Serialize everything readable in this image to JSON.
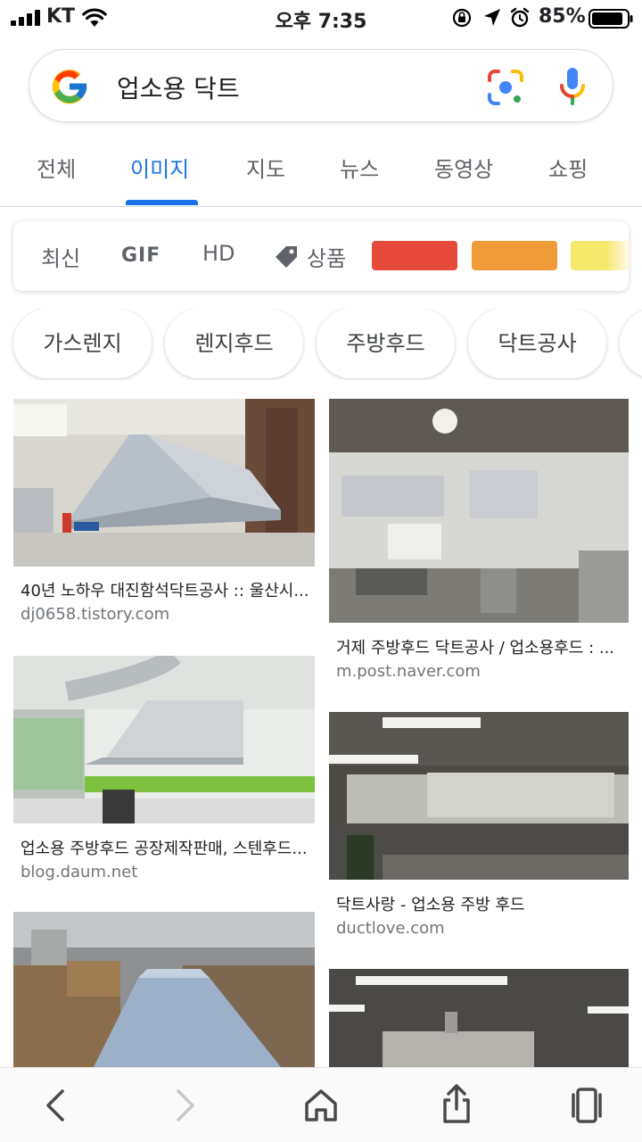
{
  "status_bar": {
    "carrier": "KT",
    "time": "오후 7:35",
    "battery": "85%"
  },
  "search": {
    "query": "업소용 닥트"
  },
  "tabs": [
    {
      "label": "전체"
    },
    {
      "label": "이미지"
    },
    {
      "label": "지도"
    },
    {
      "label": "뉴스"
    },
    {
      "label": "동영상"
    },
    {
      "label": "쇼핑"
    }
  ],
  "filters": {
    "newest": "최신",
    "gif": "GIF",
    "hd": "HD",
    "products": "상품",
    "colors": [
      "#e64a3b",
      "#f19a38",
      "#f7e76a"
    ]
  },
  "chips": [
    {
      "label": "가스렌지"
    },
    {
      "label": "렌지후드"
    },
    {
      "label": "주방후드"
    },
    {
      "label": "닥트공사"
    }
  ],
  "results": [
    {
      "title": "40년 노하우 대진함석닥트공사 :: 울산시...",
      "domain": "dj0658.tistory.com"
    },
    {
      "title": "거제 주방후드 닥트공사 / 업소용후드 : ...",
      "domain": "m.post.naver.com"
    },
    {
      "title": "업소용 주방후드 공장제작판매, 스텐후드...",
      "domain": "blog.daum.net"
    },
    {
      "title": "닥트사랑 - 업소용 주방 후드",
      "domain": "ductlove.com"
    }
  ]
}
